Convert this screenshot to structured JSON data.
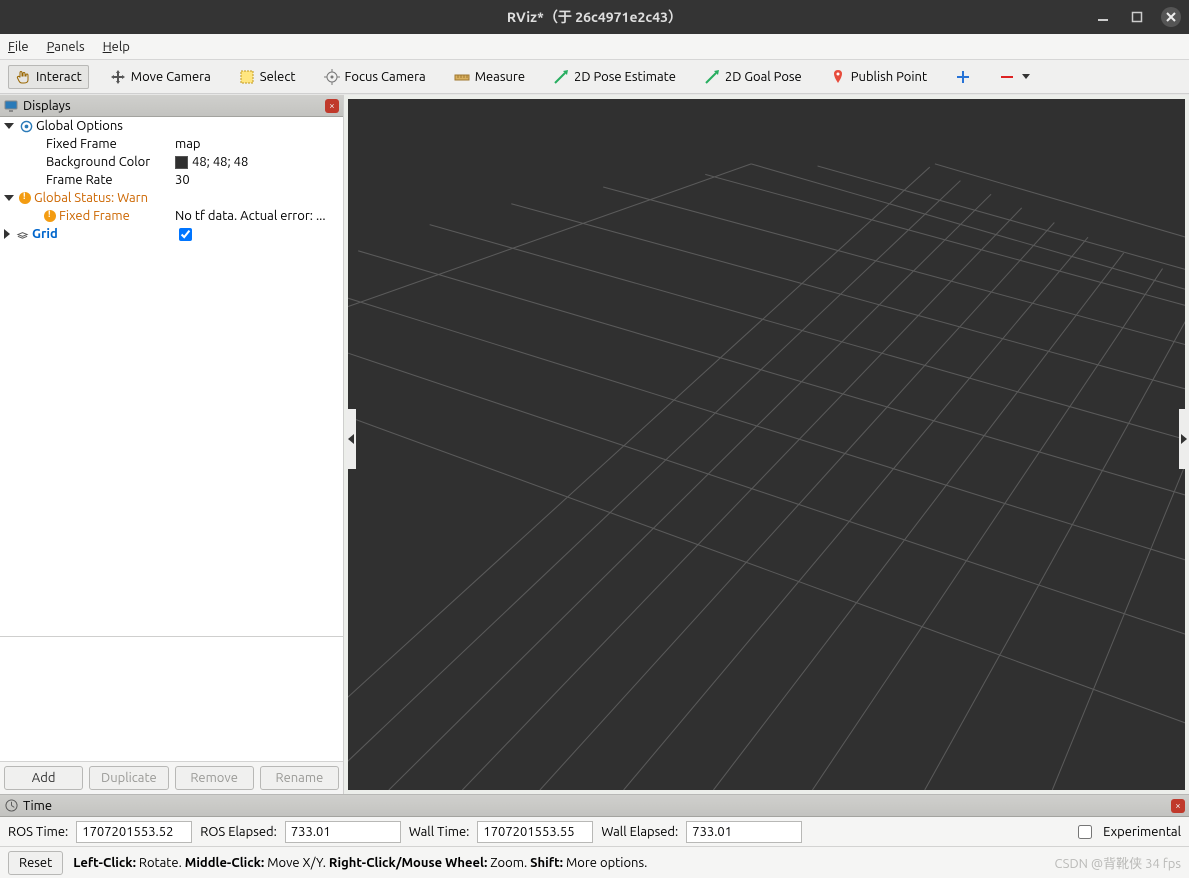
{
  "title": "RViz*（于 26c4971e2c43）",
  "menu": {
    "file": "File",
    "panels": "Panels",
    "help": "Help"
  },
  "toolbar": {
    "interact": "Interact",
    "move_camera": "Move Camera",
    "select": "Select",
    "focus_camera": "Focus Camera",
    "measure": "Measure",
    "pose_estimate": "2D Pose Estimate",
    "goal_pose": "2D Goal Pose",
    "publish_point": "Publish Point"
  },
  "displays": {
    "panel_title": "Displays",
    "global_options": "Global Options",
    "fixed_frame_label": "Fixed Frame",
    "fixed_frame_value": "map",
    "background_color_label": "Background Color",
    "background_color_value": "48; 48; 48",
    "frame_rate_label": "Frame Rate",
    "frame_rate_value": "30",
    "global_status": "Global Status: Warn",
    "status_fixed_label": "Fixed Frame",
    "status_fixed_value": "No tf data.  Actual error: ...",
    "grid_label": "Grid",
    "grid_checked": true
  },
  "buttons": {
    "add": "Add",
    "duplicate": "Duplicate",
    "remove": "Remove",
    "rename": "Rename"
  },
  "time": {
    "panel_title": "Time",
    "ros_time_label": "ROS Time:",
    "ros_time_value": "1707201553.52",
    "ros_elapsed_label": "ROS Elapsed:",
    "ros_elapsed_value": "733.01",
    "wall_time_label": "Wall Time:",
    "wall_time_value": "1707201553.55",
    "wall_elapsed_label": "Wall Elapsed:",
    "wall_elapsed_value": "733.01",
    "experimental": "Experimental"
  },
  "status": {
    "reset": "Reset",
    "left_click_b": "Left-Click:",
    "left_click": " Rotate. ",
    "middle_click_b": "Middle-Click:",
    "middle_click": " Move X/Y. ",
    "right_click_b": "Right-Click/Mouse Wheel:",
    "right_click": " Zoom. ",
    "shift_b": "Shift:",
    "shift": " More options."
  },
  "watermark": "CSDN @背靴侠  34 fps"
}
